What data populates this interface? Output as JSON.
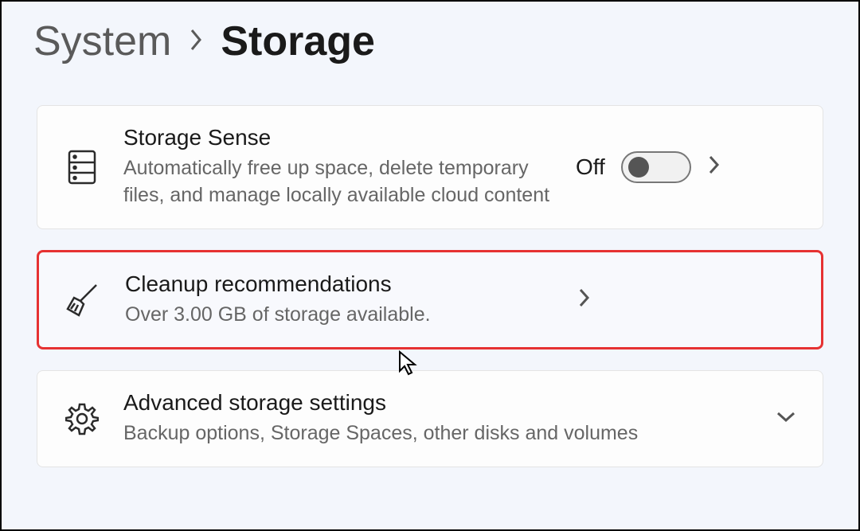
{
  "breadcrumb": {
    "parent": "System",
    "current": "Storage"
  },
  "cards": {
    "storage_sense": {
      "title": "Storage Sense",
      "subtitle": "Automatically free up space, delete temporary files, and manage locally available cloud content",
      "toggle_state": "Off"
    },
    "cleanup": {
      "title": "Cleanup recommendations",
      "subtitle": "Over 3.00 GB of storage available."
    },
    "advanced": {
      "title": "Advanced storage settings",
      "subtitle": "Backup options, Storage Spaces, other disks and volumes"
    }
  }
}
